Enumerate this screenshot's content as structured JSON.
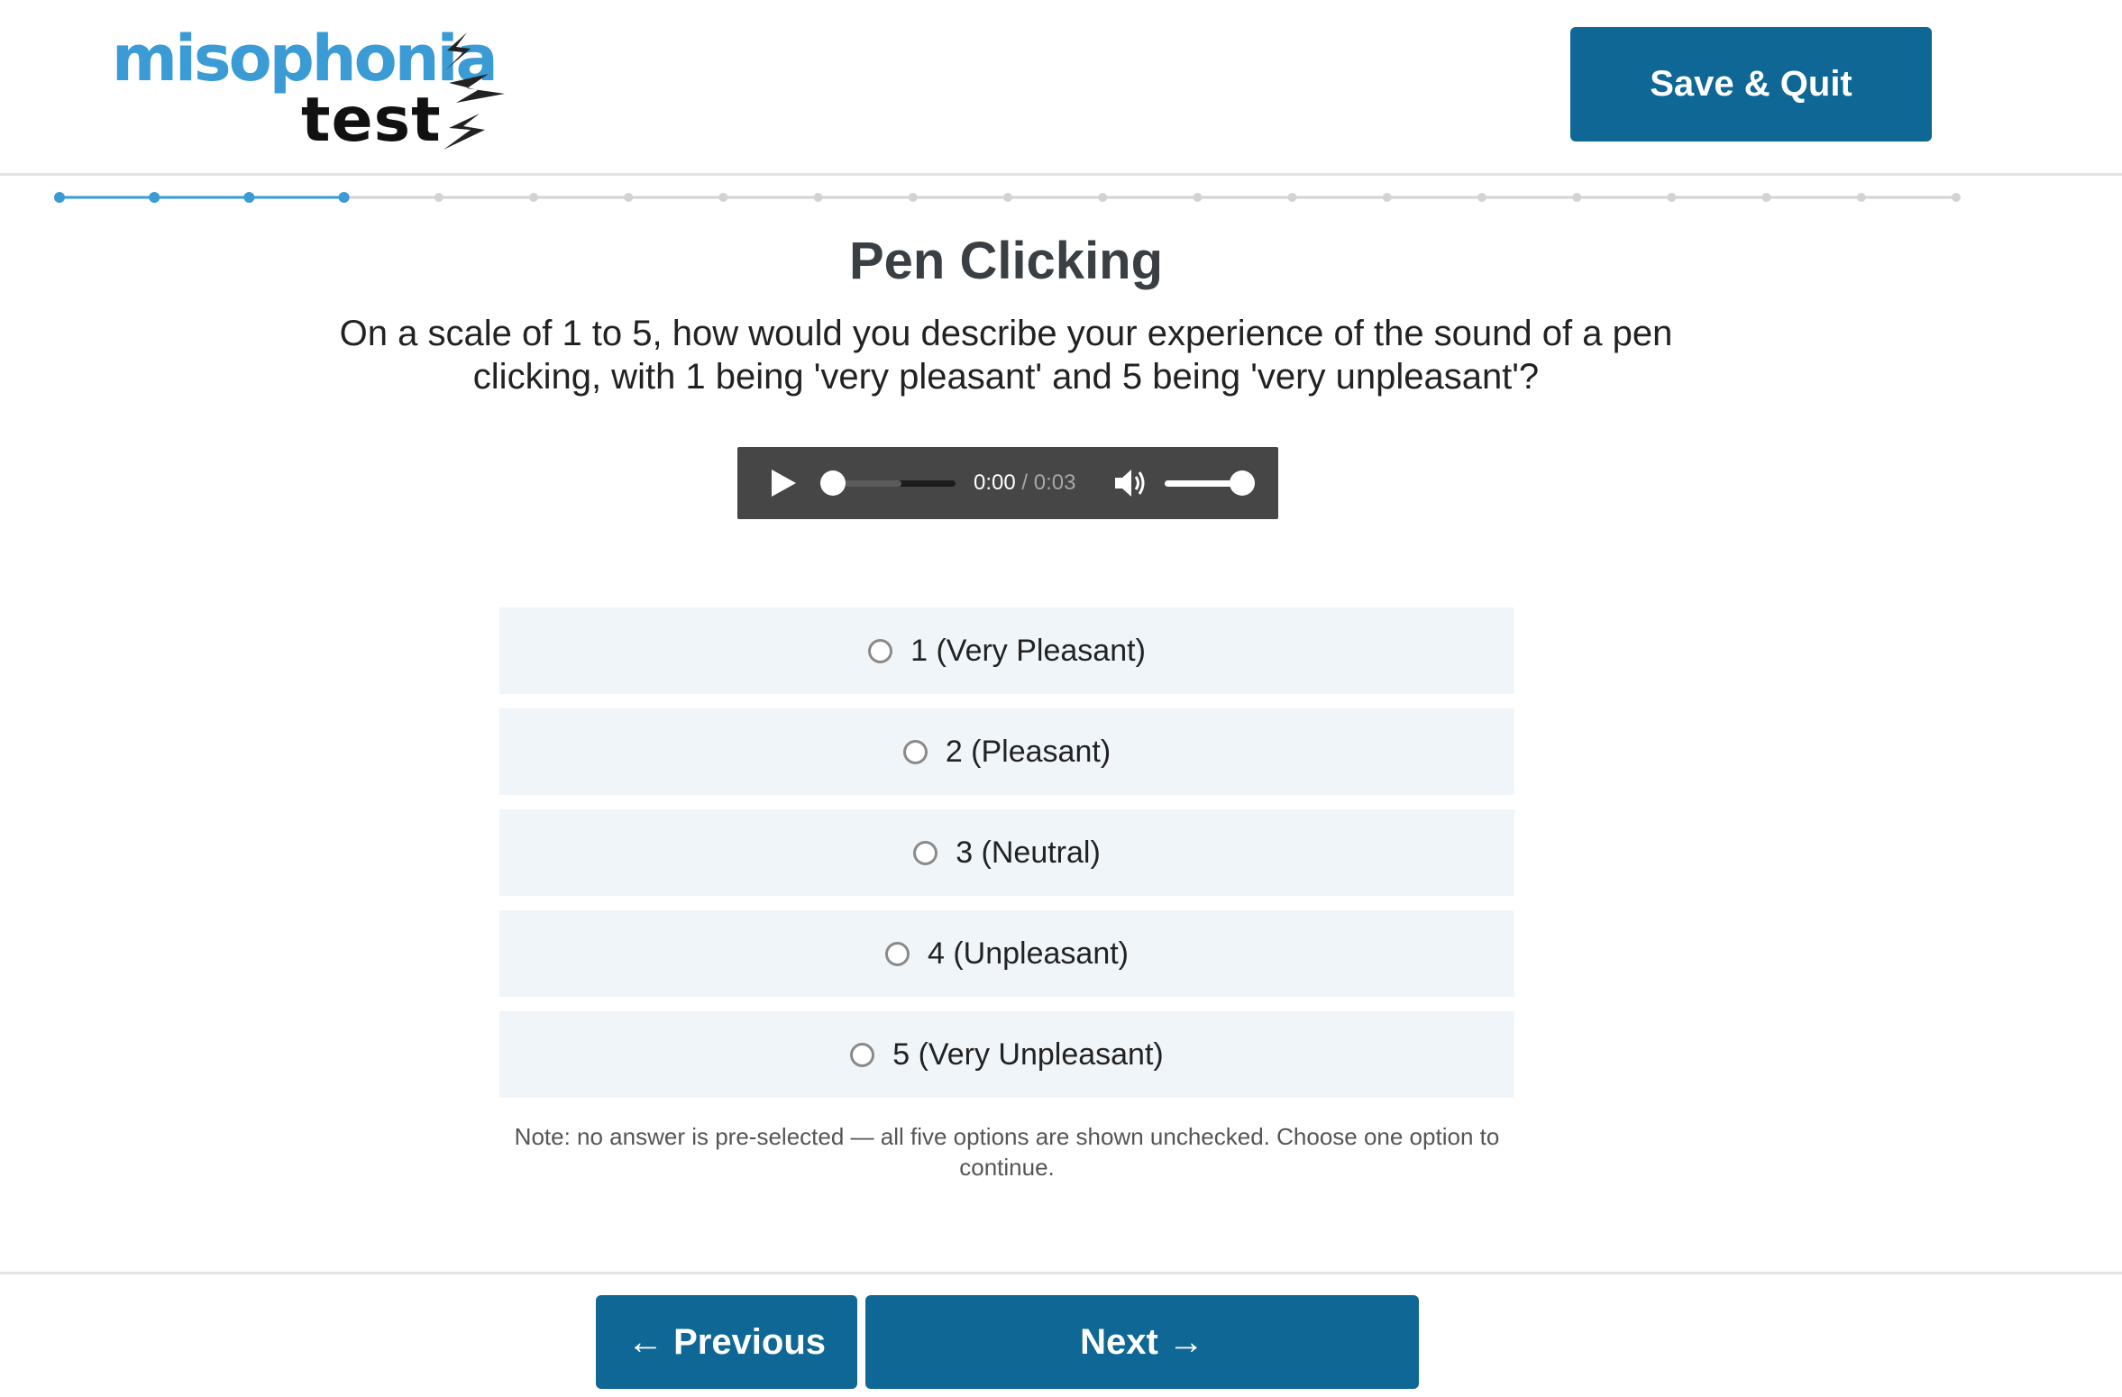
{
  "header": {
    "logo": {
      "word_top": "misophonia",
      "word_bottom": "test",
      "icon": "lightning-bolts-icon"
    },
    "save_quit_label": "Save & Quit"
  },
  "progress": {
    "total_steps": 21,
    "completed_steps": 4,
    "active_color": "#3a9bd5",
    "inactive_color": "#d3d3d3"
  },
  "question": {
    "title": "Pen Clicking",
    "text": "On a scale of 1 to 5, how would you describe your experience of the sound of a pen clicking, with 1 being 'very pleasant' and 5 being 'very unpleasant'?"
  },
  "audio": {
    "current_time": "0:00",
    "separator": " / ",
    "duration": "0:03",
    "play_icon": "play-icon",
    "volume_icon": "volume-icon",
    "volume_level": 1.0,
    "seek_position": 0.0
  },
  "options": [
    {
      "label": "1 (Very Pleasant)",
      "selected": false
    },
    {
      "label": "2 (Pleasant)",
      "selected": false
    },
    {
      "label": "3 (Neutral)",
      "selected": false
    },
    {
      "label": "4 (Unpleasant)",
      "selected": false
    },
    {
      "label": "5 (Very Unpleasant)",
      "selected": false
    }
  ],
  "note": "Note: no answer is pre-selected — all five options are shown unchecked. Choose one option to continue.",
  "footer": {
    "previous_label": "← Previous",
    "next_label": "Next →"
  },
  "colors": {
    "brand": "#0e6794",
    "logo_blue": "#3a9bd5",
    "option_bg": "#f0f5fa",
    "player_bg": "#464646"
  }
}
